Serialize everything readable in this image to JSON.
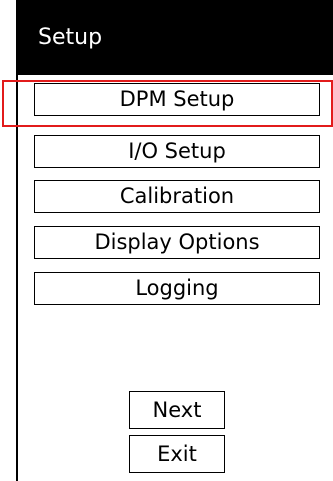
{
  "window": {
    "title": "Setup"
  },
  "menu": {
    "items": [
      {
        "label": "DPM Setup"
      },
      {
        "label": "I/O Setup"
      },
      {
        "label": "Calibration"
      },
      {
        "label": "Display Options"
      },
      {
        "label": "Logging"
      }
    ]
  },
  "nav": {
    "next_label": "Next",
    "exit_label": "Exit"
  },
  "colors": {
    "titlebar_bg": "#000000",
    "highlight": "#e21b1b"
  }
}
